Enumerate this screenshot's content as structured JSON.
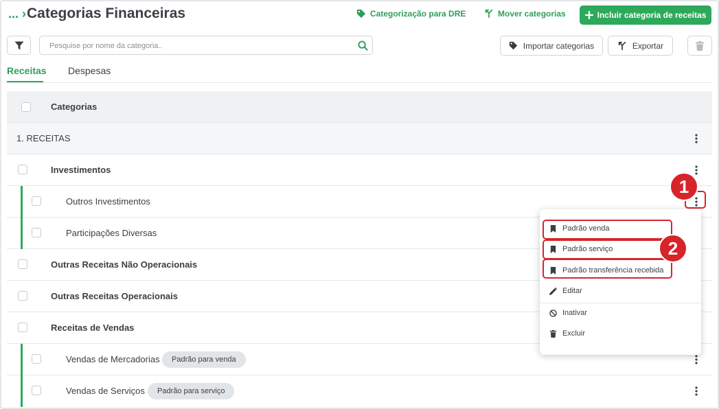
{
  "header": {
    "breadcrumb": "...",
    "title": "Categorias Financeiras",
    "link_dre": "Categorização para DRE",
    "link_move": "Mover categorias",
    "primary_button": "Incluir categoria de receitas"
  },
  "toolbar": {
    "search_placeholder": "Pesquise por nome da categoria..",
    "import_label": "Importar categorias",
    "export_label": "Exportar"
  },
  "tabs": [
    {
      "label": "Receitas",
      "active": true
    },
    {
      "label": "Despesas",
      "active": false
    }
  ],
  "table": {
    "header": "Categorias",
    "section": "1. RECEITAS",
    "rows": [
      {
        "label": "Investimentos",
        "level": 1
      },
      {
        "label": "Outros Investimentos",
        "level": 2
      },
      {
        "label": "Participações Diversas",
        "level": 2
      },
      {
        "label": "Outras Receitas Não Operacionais",
        "level": 1
      },
      {
        "label": "Outras Receitas Operacionais",
        "level": 1
      },
      {
        "label": "Receitas de Vendas",
        "level": 1
      },
      {
        "label": "Vendas de Mercadorias",
        "level": 2,
        "badge": "Padrão para venda"
      },
      {
        "label": "Vendas de Serviços",
        "level": 2,
        "badge": "Padrão para serviço"
      }
    ]
  },
  "menu": {
    "items": [
      {
        "label": "Padrão venda",
        "icon": "bookmark-icon"
      },
      {
        "label": "Padrão serviço",
        "icon": "bookmark-icon"
      },
      {
        "label": "Padrão transferência recebida",
        "icon": "bookmark-icon"
      },
      {
        "label": "Editar",
        "icon": "pencil-icon"
      },
      {
        "label": "Inativar",
        "icon": "block-icon"
      },
      {
        "label": "Excluir",
        "icon": "trash-icon"
      }
    ]
  },
  "annotations": [
    "1",
    "2"
  ],
  "colors": {
    "accent": "#2ea95b",
    "highlight": "#d6242a",
    "header_bg": "#f0f1f3"
  }
}
